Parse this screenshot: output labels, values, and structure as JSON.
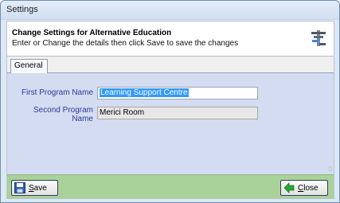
{
  "window": {
    "title": "Settings"
  },
  "header": {
    "title": "Change Settings for Alternative Education",
    "subtitle": "Enter or Change the details then click Save to save the changes",
    "icon": "settings-tool-icon"
  },
  "tabs": [
    {
      "label": "General"
    }
  ],
  "form": {
    "first_program": {
      "label": "First Program Name",
      "value": "Learning Support Centre"
    },
    "second_program": {
      "label": "Second Program Name",
      "value": "Merici Room"
    },
    "corner_glyph": "0"
  },
  "footer": {
    "save": {
      "label_prefix": "",
      "label_underline": "S",
      "label_rest": "ave",
      "icon": "floppy-disk-icon"
    },
    "close": {
      "label_prefix": "",
      "label_underline": "C",
      "label_rest": "lose",
      "icon": "arrow-left-icon"
    }
  },
  "colors": {
    "panel": "#d3dcf0",
    "footer": "#a9d29a",
    "label": "#2d3a9a",
    "selection": "#3399ff"
  }
}
